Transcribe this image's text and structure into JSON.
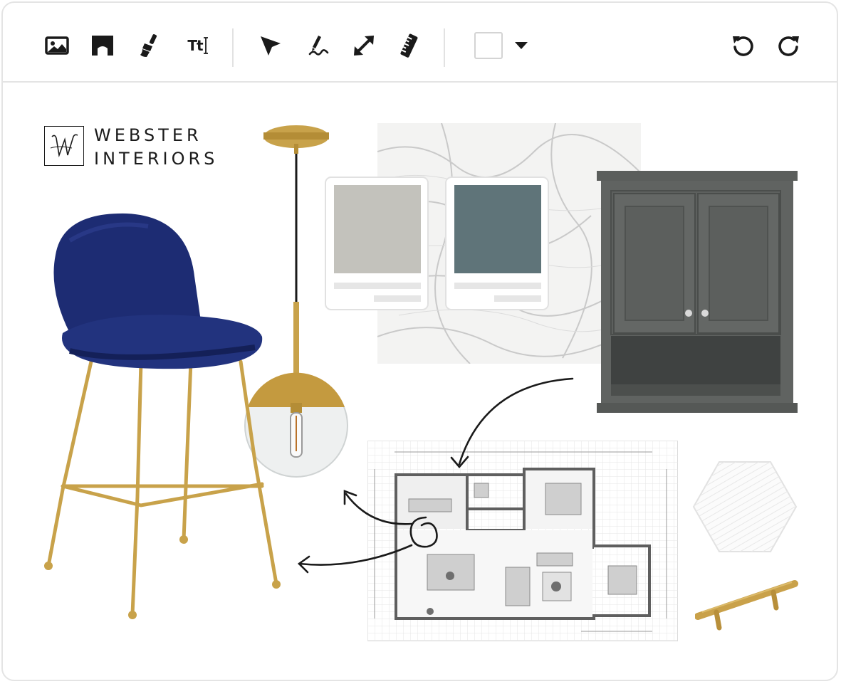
{
  "toolbar": {
    "tools": [
      {
        "name": "image-icon",
        "label": "Add image"
      },
      {
        "name": "shape-icon",
        "label": "Add shape"
      },
      {
        "name": "paint-brush-icon",
        "label": "Brush"
      },
      {
        "name": "text-icon",
        "label": "Tt"
      },
      {
        "name": "pointer-arrow-icon",
        "label": "Select"
      },
      {
        "name": "freehand-pen-icon",
        "label": "Draw"
      },
      {
        "name": "resize-arrow-icon",
        "label": "Arrow"
      },
      {
        "name": "ruler-icon",
        "label": "Measure"
      }
    ],
    "text_tool_label": "Tt",
    "color_swatch": "#ffffff",
    "dropdown_icon": "caret-down-icon",
    "undo_icon": "undo-icon",
    "redo_icon": "redo-icon"
  },
  "brand": {
    "line1": "WEBSTER",
    "line2": "INTERIORS",
    "monogram": "W"
  },
  "paint_samples": [
    {
      "color": "#c3c2bc"
    },
    {
      "color": "#5f7479"
    }
  ],
  "items": [
    "blue-velvet-bar-stool",
    "brass-globe-pendant-light",
    "white-marble-sample",
    "gray-wall-cabinet",
    "floor-plan",
    "white-hexagon-tile",
    "brass-cabinet-pull"
  ],
  "colors": {
    "stool_velvet": "#1d2c73",
    "brass": "#c8a24a",
    "cabinet": "#5a5d5b",
    "border": "#e4e4e4"
  }
}
